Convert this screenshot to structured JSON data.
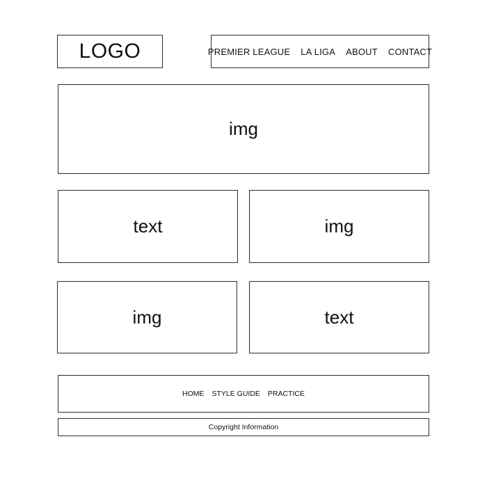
{
  "header": {
    "logo": "LOGO",
    "nav": [
      "PREMIER LEAGUE",
      "LA LIGA",
      "ABOUT",
      "CONTACT"
    ]
  },
  "hero": {
    "label": "img"
  },
  "rows": [
    [
      "text",
      "img"
    ],
    [
      "img",
      "text"
    ]
  ],
  "footer": {
    "nav": [
      "HOME",
      "STYLE GUIDE",
      "PRACTICE"
    ],
    "copyright": "Copyright Information"
  }
}
